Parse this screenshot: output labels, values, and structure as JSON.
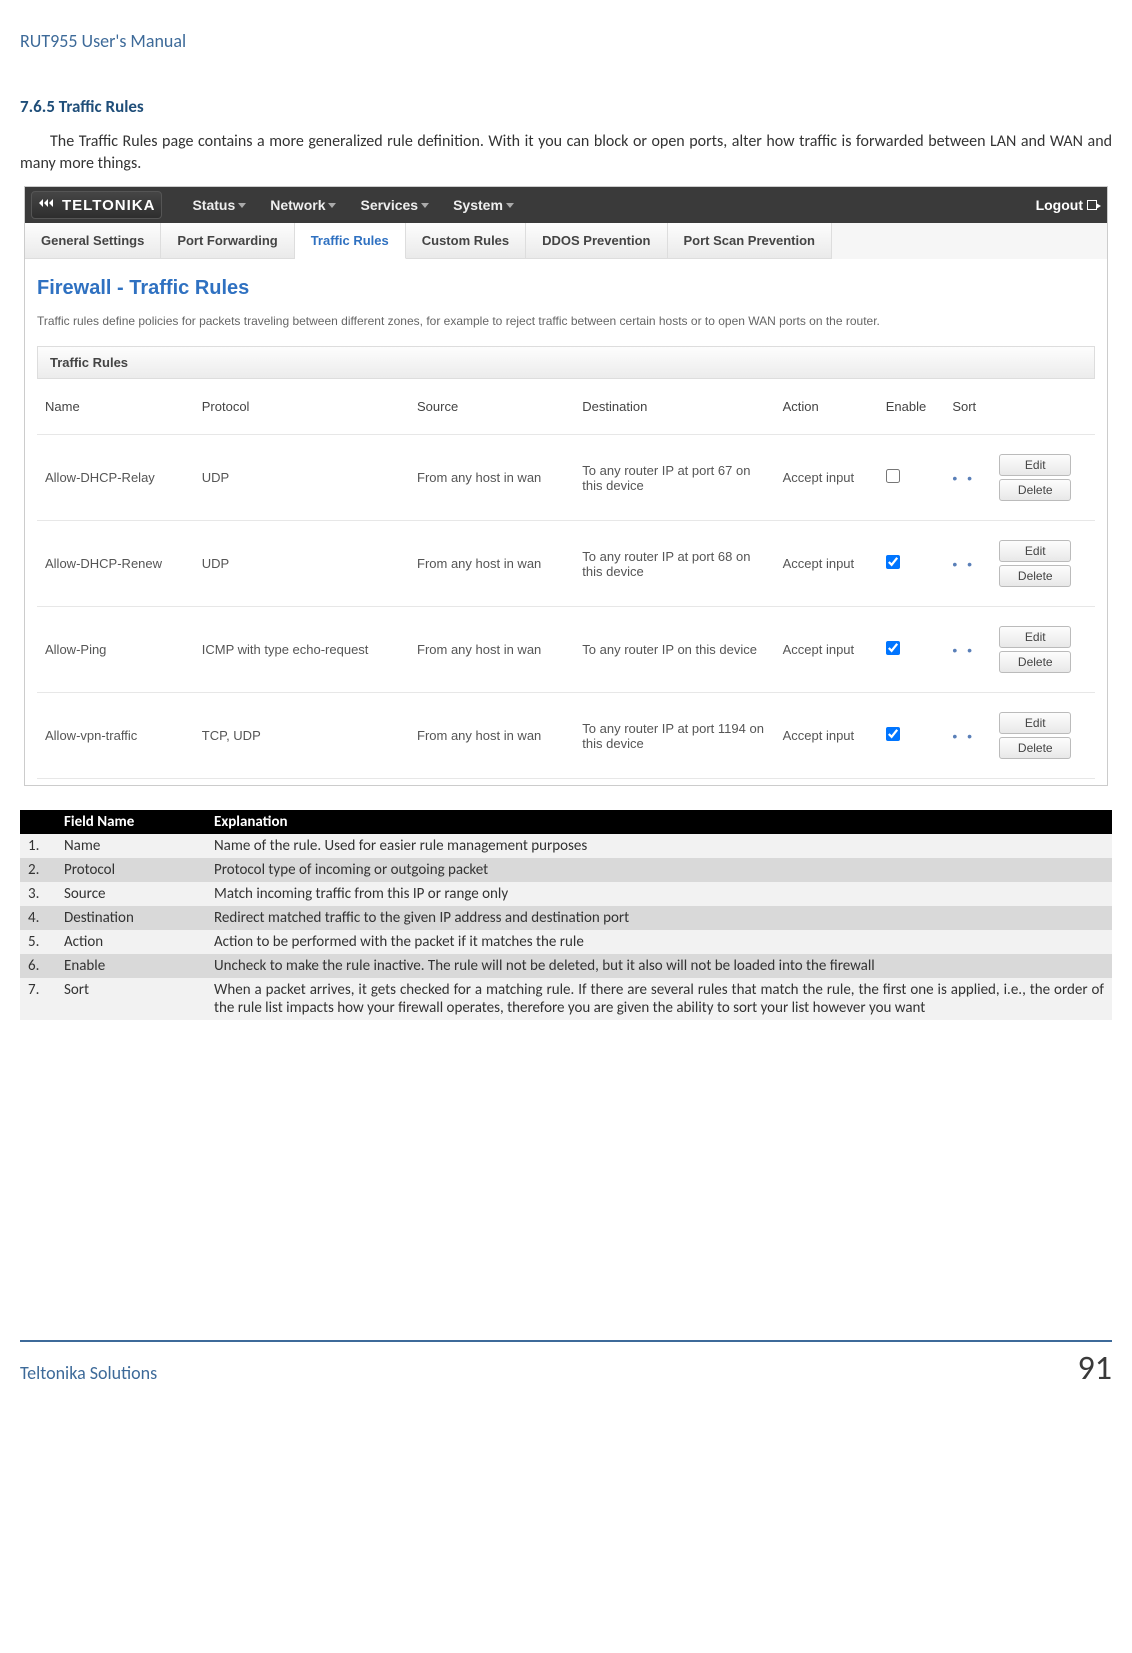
{
  "doc_header": "RUT955 User's Manual",
  "section_title": "7.6.5 Traffic Rules",
  "intro": "The Traffic Rules page contains a more generalized rule definition. With it you can block or open ports, alter how traffic is forwarded between LAN and WAN and many more things.",
  "screenshot": {
    "brand": "TELTONIKA",
    "topnav": [
      "Status",
      "Network",
      "Services",
      "System"
    ],
    "logout": "Logout",
    "subnav": {
      "items": [
        "General Settings",
        "Port Forwarding",
        "Traffic Rules",
        "Custom Rules",
        "DDOS Prevention",
        "Port Scan Prevention"
      ],
      "active_index": 2
    },
    "panel_title": "Firewall - Traffic Rules",
    "panel_desc": "Traffic rules define policies for packets traveling between different zones, for example to reject traffic between certain hosts or to open WAN ports on the router.",
    "box_title": "Traffic Rules",
    "columns": [
      "Name",
      "Protocol",
      "Source",
      "Destination",
      "Action",
      "Enable",
      "Sort",
      ""
    ],
    "edit_label": "Edit",
    "delete_label": "Delete",
    "rules": [
      {
        "name": "Allow-DHCP-Relay",
        "protocol": "UDP",
        "source": "From any host in wan",
        "destination": "To any router IP at port 67 on this device",
        "action": "Accept input",
        "enabled": false
      },
      {
        "name": "Allow-DHCP-Renew",
        "protocol": "UDP",
        "source": "From any host in wan",
        "destination": "To any router IP at port 68 on this device",
        "action": "Accept input",
        "enabled": true
      },
      {
        "name": "Allow-Ping",
        "protocol": "ICMP with type echo-request",
        "source": "From any host in wan",
        "destination": "To any router IP on this device",
        "action": "Accept input",
        "enabled": true
      },
      {
        "name": "Allow-vpn-traffic",
        "protocol": "TCP, UDP",
        "source": "From any host in wan",
        "destination": "To any router IP at port 1194 on this device",
        "action": "Accept input",
        "enabled": true
      }
    ]
  },
  "field_table": {
    "header": {
      "num": "",
      "name": "Field Name",
      "exp": "Explanation"
    },
    "rows": [
      {
        "num": "1.",
        "name": "Name",
        "exp": "Name of the rule. Used for easier rule management purposes"
      },
      {
        "num": "2.",
        "name": "Protocol",
        "exp": "Protocol type of incoming or outgoing packet"
      },
      {
        "num": "3.",
        "name": "Source",
        "exp": "Match incoming traffic from this IP or range only"
      },
      {
        "num": "4.",
        "name": "Destination",
        "exp": "Redirect matched traffic to the given IP address and destination port"
      },
      {
        "num": "5.",
        "name": "Action",
        "exp": "Action to be performed with the packet if it matches the rule"
      },
      {
        "num": "6.",
        "name": "Enable",
        "exp": "Uncheck to make the rule inactive. The rule will not be deleted, but it also will not be loaded into the firewall"
      },
      {
        "num": "7.",
        "name": "Sort",
        "exp": "When a packet arrives, it gets checked for a matching rule. If there are several rules that match the rule, the first one is applied, i.e., the order of the rule list impacts how your firewall operates, therefore you are given the ability to sort your list however you want"
      }
    ]
  },
  "footer": {
    "left": "Teltonika Solutions",
    "right": "91"
  }
}
